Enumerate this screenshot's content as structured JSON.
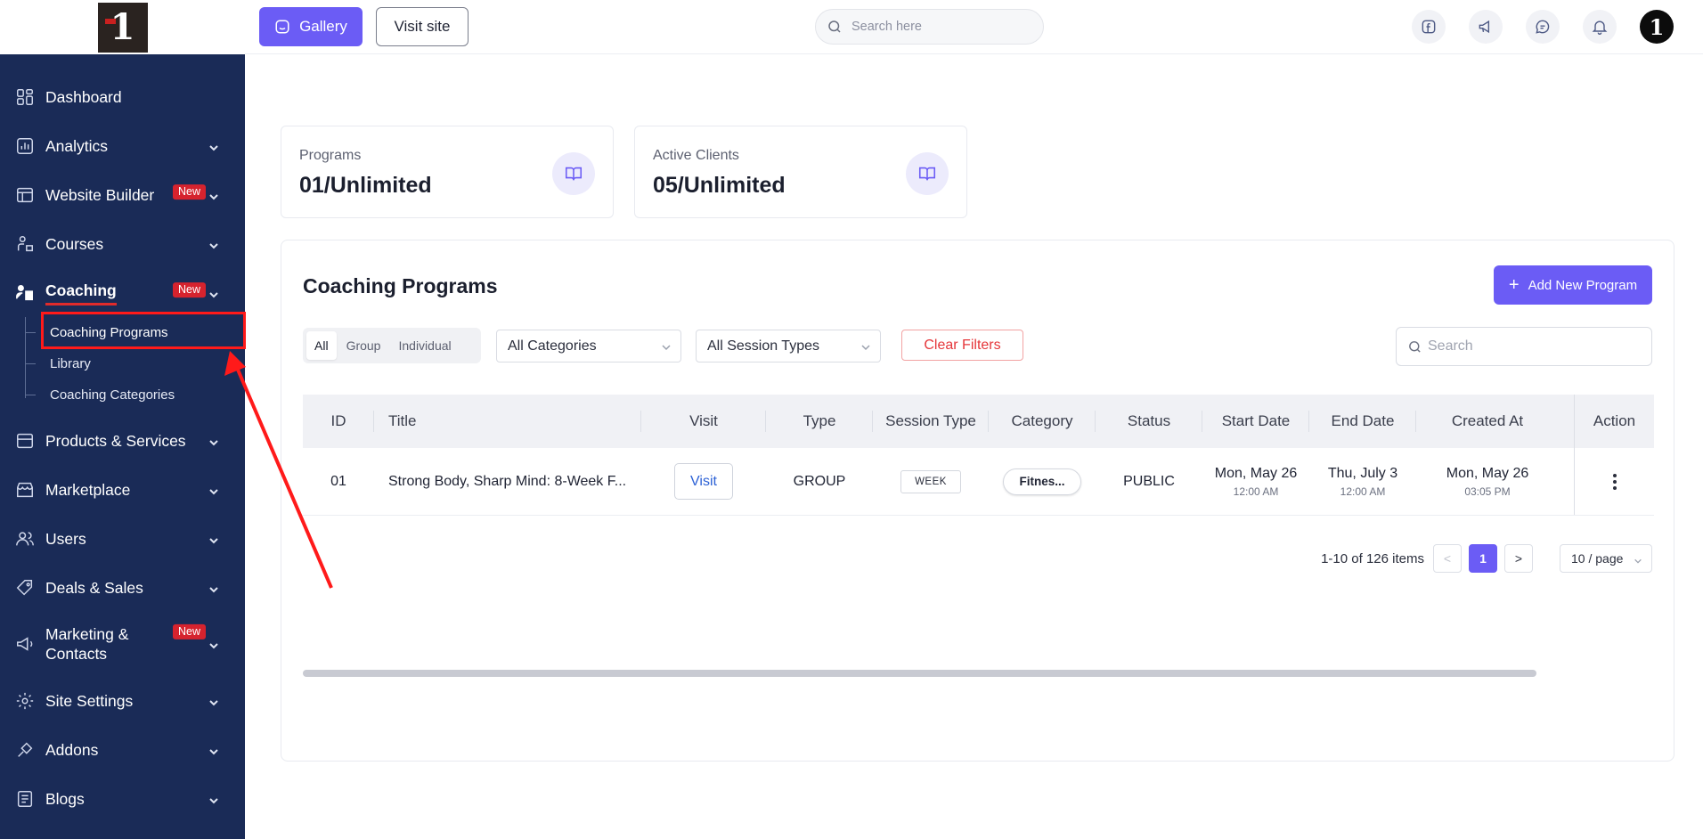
{
  "sidebar": {
    "logo_text": "1",
    "items": [
      {
        "label": "Dashboard",
        "icon": "dashboard-icon",
        "chevron": false,
        "badge": ""
      },
      {
        "label": "Analytics",
        "icon": "analytics-icon",
        "chevron": true,
        "badge": ""
      },
      {
        "label": "Website Builder",
        "icon": "website-builder-icon",
        "chevron": true,
        "badge": "New"
      },
      {
        "label": "Courses",
        "icon": "courses-icon",
        "chevron": true,
        "badge": ""
      },
      {
        "label": "Coaching",
        "icon": "coaching-icon",
        "chevron": true,
        "badge": "New",
        "active": true
      },
      {
        "label": "Products & Services",
        "icon": "products-icon",
        "chevron": true,
        "badge": ""
      },
      {
        "label": "Marketplace",
        "icon": "marketplace-icon",
        "chevron": true,
        "badge": ""
      },
      {
        "label": "Users",
        "icon": "users-icon",
        "chevron": true,
        "badge": ""
      },
      {
        "label": "Deals & Sales",
        "icon": "deals-icon",
        "chevron": true,
        "badge": ""
      },
      {
        "label": "Marketing & Contacts",
        "icon": "megaphone-icon",
        "chevron": true,
        "badge": "New"
      },
      {
        "label": "Site Settings",
        "icon": "settings-gear-icon",
        "chevron": true,
        "badge": ""
      },
      {
        "label": "Addons",
        "icon": "addons-icon",
        "chevron": true,
        "badge": ""
      },
      {
        "label": "Blogs",
        "icon": "blogs-icon",
        "chevron": true,
        "badge": ""
      }
    ],
    "coaching_sub": [
      {
        "label": "Coaching Programs",
        "selected": true
      },
      {
        "label": "Library",
        "selected": false
      },
      {
        "label": "Coaching Categories",
        "selected": false
      }
    ]
  },
  "topbar": {
    "gallery_label": "Gallery",
    "visit_site_label": "Visit site",
    "search_placeholder": "Search here",
    "avatar_text": "1"
  },
  "stats": [
    {
      "title": "Programs",
      "value": "01/Unlimited",
      "icon": "book-open-icon"
    },
    {
      "title": "Active Clients",
      "value": "05/Unlimited",
      "icon": "book-open-icon"
    }
  ],
  "panel": {
    "title": "Coaching Programs",
    "add_label": "Add New Program",
    "segments": [
      "All",
      "Group",
      "Individual"
    ],
    "segment_active": "All",
    "category_select": "All Categories",
    "session_select": "All Session Types",
    "clear_filters": "Clear Filters",
    "search_placeholder": "Search"
  },
  "table": {
    "columns": [
      "ID",
      "Title",
      "Visit",
      "Type",
      "Session Type",
      "Category",
      "Status",
      "Start Date",
      "End Date",
      "Created At",
      "Action"
    ],
    "rows": [
      {
        "id": "01",
        "title": "Strong Body, Sharp Mind: 8-Week F...",
        "visit": "Visit",
        "type": "GROUP",
        "session_type": "WEEK",
        "category": "Fitnes...",
        "status": "PUBLIC",
        "start_date": "Mon, May 26",
        "start_time": "12:00 AM",
        "end_date": "Thu, July 3",
        "end_time": "12:00 AM",
        "created_date": "Mon, May 26",
        "created_time": "03:05 PM"
      }
    ]
  },
  "pagination": {
    "total": "1-10 of 126 items",
    "prev": "<",
    "current": "1",
    "next": ">",
    "page_size": "10 / page"
  },
  "colors": {
    "sidebar_bg": "#1a2b57",
    "accent": "#6b5cf5",
    "badge_red": "#d6232e",
    "annotation_red": "#ff1a1a"
  }
}
